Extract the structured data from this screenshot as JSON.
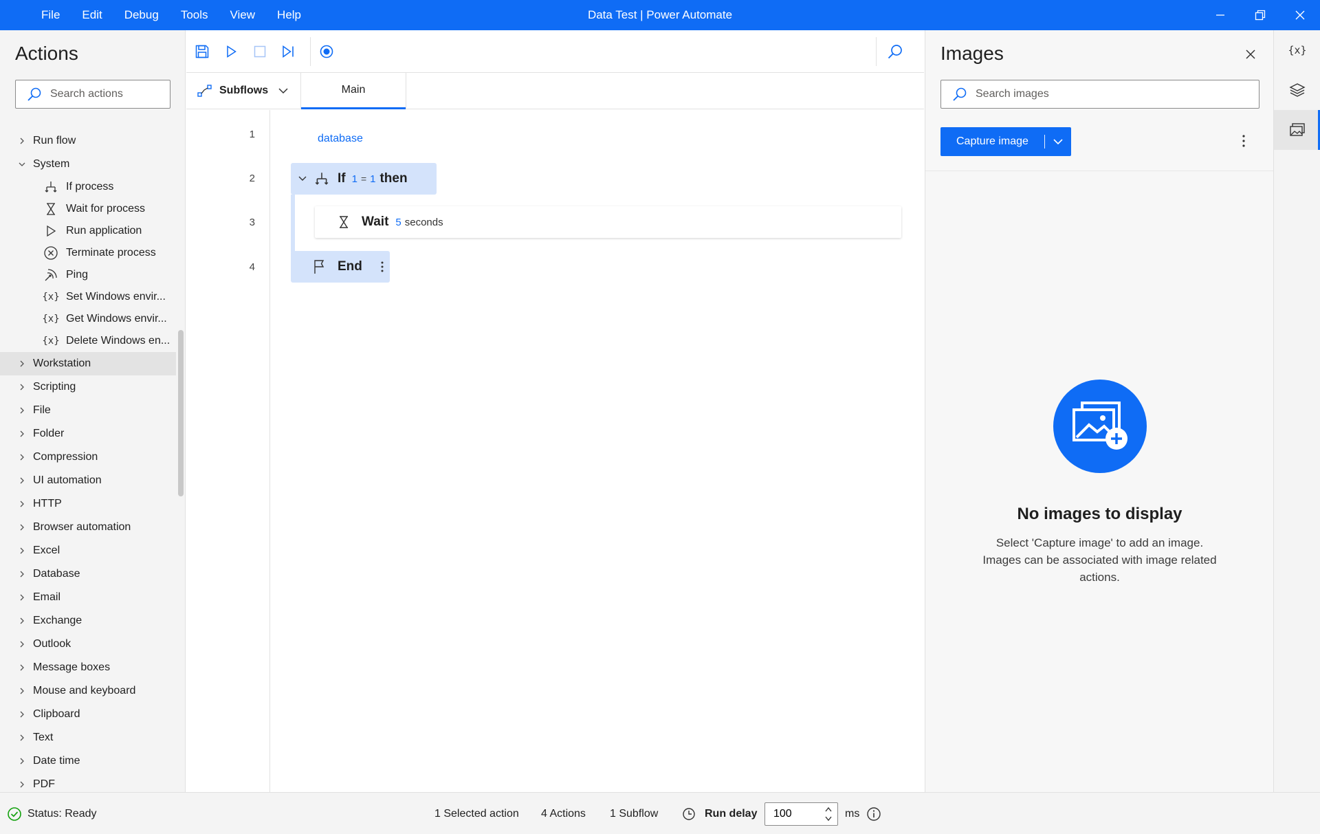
{
  "window": {
    "title": "Data Test | Power Automate",
    "menu": [
      "File",
      "Edit",
      "Debug",
      "Tools",
      "View",
      "Help"
    ]
  },
  "actions_panel": {
    "title": "Actions",
    "search_placeholder": "Search actions",
    "top_groups": [
      {
        "label": "Run flow",
        "expanded": false
      },
      {
        "label": "System",
        "expanded": true
      }
    ],
    "system_items": [
      {
        "label": "If process",
        "icon": "if-process-icon"
      },
      {
        "label": "Wait for process",
        "icon": "hourglass-icon"
      },
      {
        "label": "Run application",
        "icon": "play-icon"
      },
      {
        "label": "Terminate process",
        "icon": "circle-x-icon"
      },
      {
        "label": "Ping",
        "icon": "ping-icon"
      },
      {
        "label": "Set Windows envir...",
        "icon": "variable-icon",
        "glyph": "{x}"
      },
      {
        "label": "Get Windows envir...",
        "icon": "variable-icon",
        "glyph": "{x}"
      },
      {
        "label": "Delete Windows en...",
        "icon": "variable-icon",
        "glyph": "{x}"
      }
    ],
    "groups": [
      "Workstation",
      "Scripting",
      "File",
      "Folder",
      "Compression",
      "UI automation",
      "HTTP",
      "Browser automation",
      "Excel",
      "Database",
      "Email",
      "Exchange",
      "Outlook",
      "Message boxes",
      "Mouse and keyboard",
      "Clipboard",
      "Text",
      "Date time",
      "PDF"
    ],
    "hovered_group": "Workstation"
  },
  "designer": {
    "subflows_label": "Subflows",
    "active_tab": "Main",
    "line_numbers": [
      "1",
      "2",
      "3",
      "4"
    ],
    "flow_label": "database",
    "if_block": {
      "keyword": "If",
      "left": "1",
      "op": "=",
      "right": "1",
      "then": "then"
    },
    "wait_block": {
      "keyword": "Wait",
      "value": "5",
      "unit": "seconds"
    },
    "end_block": {
      "keyword": "End"
    }
  },
  "images_panel": {
    "title": "Images",
    "search_placeholder": "Search images",
    "capture_label": "Capture image",
    "empty_title": "No images to display",
    "empty_desc": "Select 'Capture image' to add an image. Images can be associated with image related actions."
  },
  "rail": {
    "variables_glyph": "{x}"
  },
  "statusbar": {
    "status": "Status: Ready",
    "selected": "1 Selected action",
    "actions_count": "4 Actions",
    "subflow_count": "1 Subflow",
    "run_delay_label": "Run delay",
    "run_delay_value": "100",
    "unit": "ms"
  },
  "colors": {
    "accent": "#0f6cf5",
    "block_highlight": "#d4e3fb",
    "status_ok": "#13a10e"
  }
}
